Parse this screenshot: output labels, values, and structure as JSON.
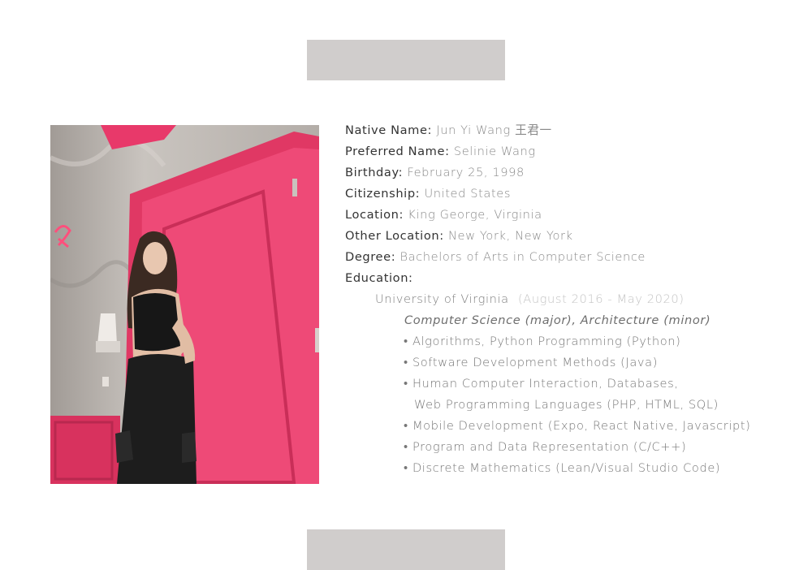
{
  "profile": {
    "native_name_label": "Native Name:",
    "native_name_value": "Jun Yi Wang 王君一",
    "preferred_name_label": "Preferred Name:",
    "preferred_name_value": "Selinie Wang",
    "birthday_label": "Birthday:",
    "birthday_value": "February 25, 1998",
    "citizenship_label": "Citizenship:",
    "citizenship_value": "United States",
    "location_label": "Location:",
    "location_value": "King George, Virginia",
    "other_location_label": "Other Location:",
    "other_location_value": "New York, New York",
    "degree_label": "Degree:",
    "degree_value": "Bachelors of Arts in Computer Science",
    "education_label": "Education:"
  },
  "education": {
    "school": "University of Virginia",
    "dates": "(August 2016 - May 2020)",
    "major": "Computer Science (major), Architecture (minor)",
    "courses": [
      "• Algorithms, Python Programming (Python)",
      "• Software Development Methods (Java)",
      "• Human Computer Interaction, Databases,",
      "Web Programming Languages (PHP, HTML, SQL)",
      "• Mobile Development (Expo, React Native, Javascript)",
      "• Program and Data Representation (C/C++)",
      "• Discrete Mathematics (Lean/Visual Studio Code)"
    ]
  },
  "colors": {
    "placeholder_bar": "#d0cdcc",
    "label_text": "#333333",
    "value_text": "#8a8a8a",
    "door_pink": "#e8396a"
  }
}
